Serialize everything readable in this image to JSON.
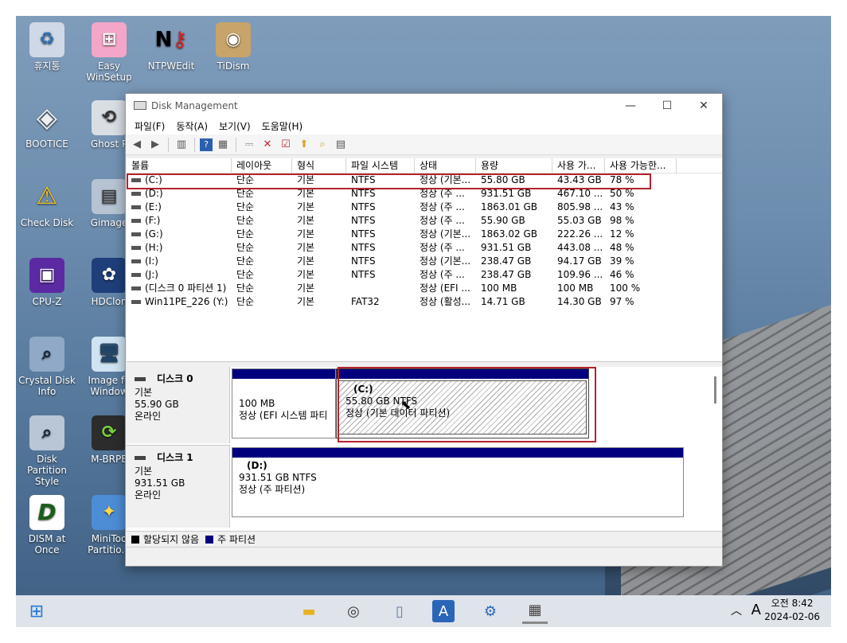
{
  "desktop": {
    "icons": [
      {
        "label": "휴지통"
      },
      {
        "label": "Easy WinSetup"
      },
      {
        "label": "NTPWEdit"
      },
      {
        "label": "TiDism"
      },
      {
        "label": "BOOTICE"
      },
      {
        "label": "Ghost P"
      },
      {
        "label": "Check Disk"
      },
      {
        "label": "Gimage"
      },
      {
        "label": "CPU-Z"
      },
      {
        "label": "HDClon"
      },
      {
        "label": "Crystal Disk Info"
      },
      {
        "label": "Image fo Window"
      },
      {
        "label": "Disk Partition Style"
      },
      {
        "label": "M-BRPE"
      },
      {
        "label": "DISM at Once"
      },
      {
        "label": "MiniToo Partitio..."
      }
    ]
  },
  "window": {
    "title": "Disk Management",
    "menu": [
      "파일(F)",
      "동작(A)",
      "보기(V)",
      "도움말(H)"
    ]
  },
  "volumes": {
    "columns": [
      "볼륨",
      "레이아웃",
      "형식",
      "파일 시스템",
      "상태",
      "용량",
      "사용 가...",
      "사용 가능한..."
    ],
    "rows": [
      [
        "(C:)",
        "단순",
        "기본",
        "NTFS",
        "정상 (기본...",
        "55.80 GB",
        "43.43 GB",
        "78 %"
      ],
      [
        "(D:)",
        "단순",
        "기본",
        "NTFS",
        "정상 (주 ...",
        "931.51 GB",
        "467.10 ...",
        "50 %"
      ],
      [
        "(E:)",
        "단순",
        "기본",
        "NTFS",
        "정상 (주 ...",
        "1863.01 GB",
        "805.98 ...",
        "43 %"
      ],
      [
        "(F:)",
        "단순",
        "기본",
        "NTFS",
        "정상 (주 ...",
        "55.90 GB",
        "55.03 GB",
        "98 %"
      ],
      [
        "(G:)",
        "단순",
        "기본",
        "NTFS",
        "정상 (기본...",
        "1863.02 GB",
        "222.26 ...",
        "12 %"
      ],
      [
        "(H:)",
        "단순",
        "기본",
        "NTFS",
        "정상 (주 ...",
        "931.51 GB",
        "443.08 ...",
        "48 %"
      ],
      [
        "(I:)",
        "단순",
        "기본",
        "NTFS",
        "정상 (기본...",
        "238.47 GB",
        "94.17 GB",
        "39 %"
      ],
      [
        "(J:)",
        "단순",
        "기본",
        "NTFS",
        "정상 (주 ...",
        "238.47 GB",
        "109.96 ...",
        "46 %"
      ],
      [
        "(디스크 0 파티션 1)",
        "단순",
        "기본",
        "",
        "정상 (EFI ...",
        "100 MB",
        "100 MB",
        "100 %"
      ],
      [
        "Win11PE_226 (Y:)",
        "단순",
        "기본",
        "FAT32",
        "정상 (활성...",
        "14.71 GB",
        "14.30 GB",
        "97 %"
      ]
    ]
  },
  "disks": [
    {
      "name": "디스크 0",
      "type": "기본",
      "size": "55.90 GB",
      "state": "온라인",
      "partitions": [
        {
          "title": "",
          "size": "100 MB",
          "status": "정상 (EFI 시스템 파티"
        },
        {
          "title": "(C:)",
          "size": "55.80 GB NTFS",
          "status": "정상 (기본 데이터 파티션)"
        }
      ]
    },
    {
      "name": "디스크 1",
      "type": "기본",
      "size": "931.51 GB",
      "state": "온라인",
      "partitions": [
        {
          "title": "(D:)",
          "size": "931.51 GB NTFS",
          "status": "정상 (주 파티션)"
        }
      ]
    }
  ],
  "legend": {
    "unallocated": "할당되지 않음",
    "primary": "주 파티션"
  },
  "taskbar": {
    "time": "오전 8:42",
    "date": "2024-02-06",
    "ime": "A"
  },
  "colors": {
    "primary_partition": "#00007f",
    "highlight": "#b4232b"
  }
}
